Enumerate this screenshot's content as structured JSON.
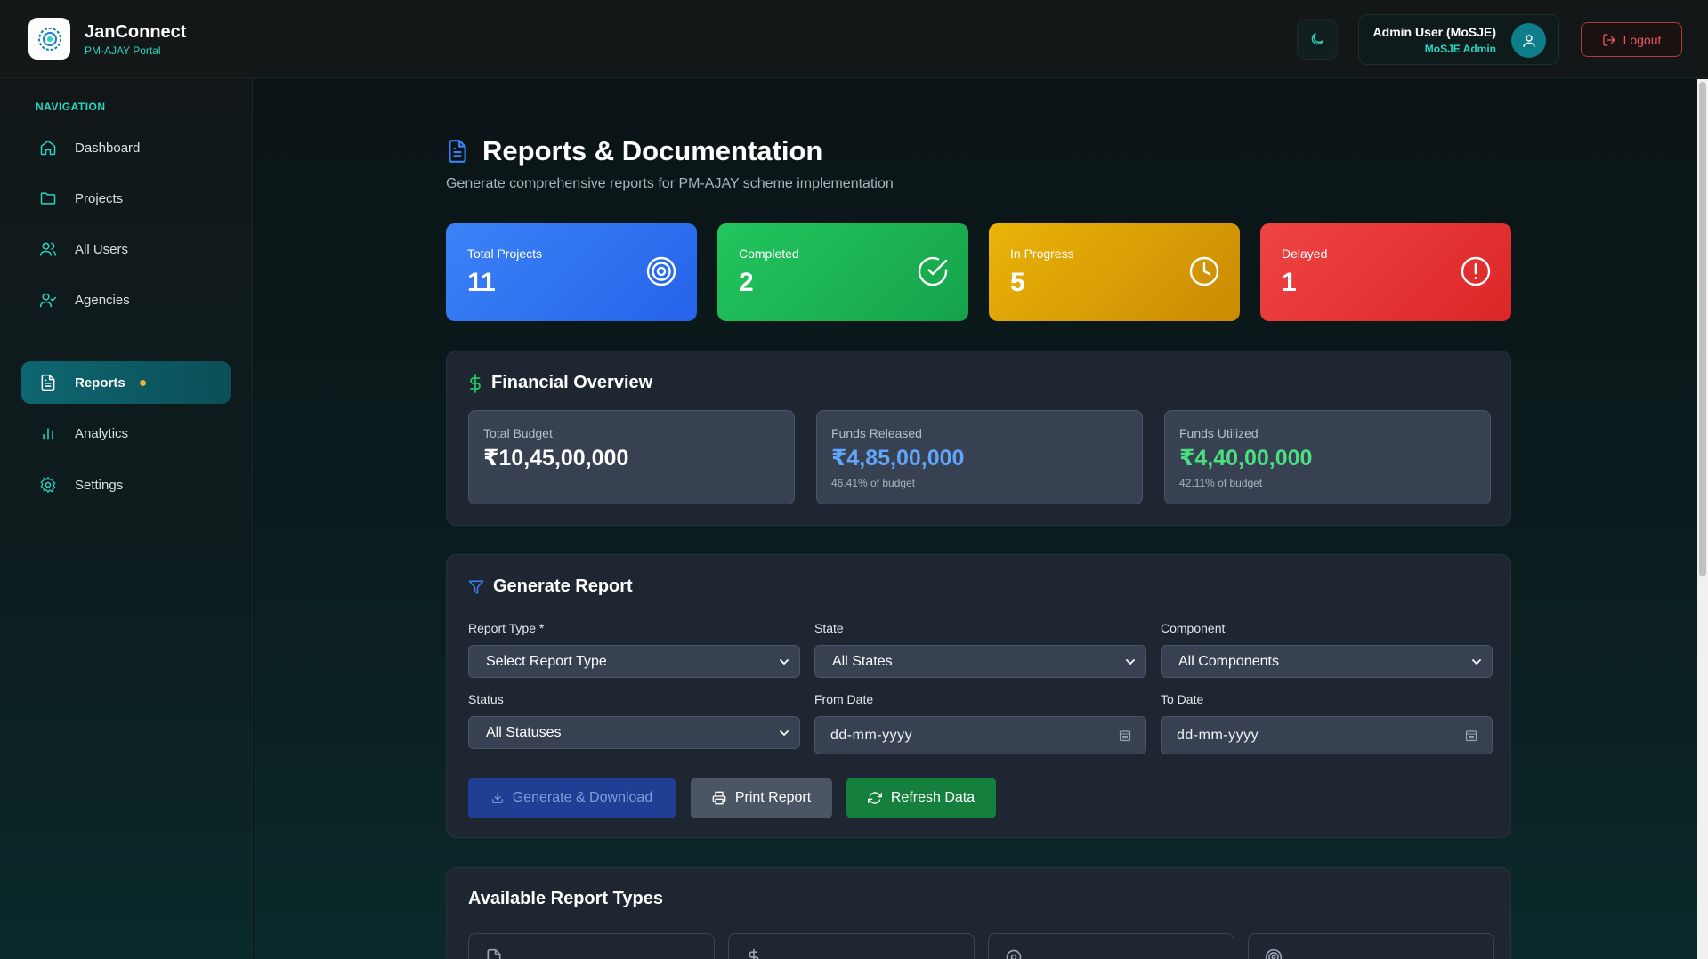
{
  "app": {
    "name": "JanConnect",
    "subtitle": "PM-AJAY Portal"
  },
  "header": {
    "user_name": "Admin User (MoSJE)",
    "user_role": "MoSJE Admin",
    "logout_label": "Logout"
  },
  "sidebar": {
    "heading": "NAVIGATION",
    "items": [
      {
        "label": "Dashboard",
        "icon": "home-icon"
      },
      {
        "label": "Projects",
        "icon": "folder-icon"
      },
      {
        "label": "All Users",
        "icon": "users-icon"
      },
      {
        "label": "Agencies",
        "icon": "user-check-icon"
      },
      {
        "label": "Reports",
        "icon": "file-text-icon",
        "active": true
      },
      {
        "label": "Analytics",
        "icon": "bar-chart-icon"
      },
      {
        "label": "Settings",
        "icon": "gear-icon"
      }
    ]
  },
  "page": {
    "title": "Reports & Documentation",
    "subtitle": "Generate comprehensive reports for PM-AJAY scheme implementation"
  },
  "stats": [
    {
      "label": "Total Projects",
      "value": "11",
      "icon": "target-icon",
      "color": "#3b82f6"
    },
    {
      "label": "Completed",
      "value": "2",
      "icon": "check-circle-icon",
      "color": "#22c55e"
    },
    {
      "label": "In Progress",
      "value": "5",
      "icon": "clock-icon",
      "color": "#eab308"
    },
    {
      "label": "Delayed",
      "value": "1",
      "icon": "alert-circle-icon",
      "color": "#ef4444"
    }
  ],
  "financial": {
    "title": "Financial Overview",
    "total_budget_label": "Total Budget",
    "total_budget_value": "₹10,45,00,000",
    "released_label": "Funds Released",
    "released_value": "₹4,85,00,000",
    "released_note": "46.41% of budget",
    "utilized_label": "Funds Utilized",
    "utilized_value": "₹4,40,00,000",
    "utilized_note": "42.11% of budget",
    "colors": {
      "released": "#60a5fa",
      "utilized": "#4ade80"
    }
  },
  "generate": {
    "title": "Generate Report",
    "report_type_label": "Report Type *",
    "report_type_value": "Select Report Type",
    "state_label": "State",
    "state_value": "All States",
    "component_label": "Component",
    "component_value": "All Components",
    "status_label": "Status",
    "status_value": "All Statuses",
    "from_date_label": "From Date",
    "from_date_placeholder": "dd-mm-yyyy",
    "to_date_label": "To Date",
    "to_date_placeholder": "dd-mm-yyyy",
    "btn_generate": "Generate & Download",
    "btn_print": "Print Report",
    "btn_refresh": "Refresh Data"
  },
  "report_types": {
    "title": "Available Report Types",
    "cards": [
      {
        "icon": "file-text-icon"
      },
      {
        "icon": "dollar-icon"
      },
      {
        "icon": "target-icon"
      },
      {
        "icon": "target-icon"
      }
    ]
  }
}
